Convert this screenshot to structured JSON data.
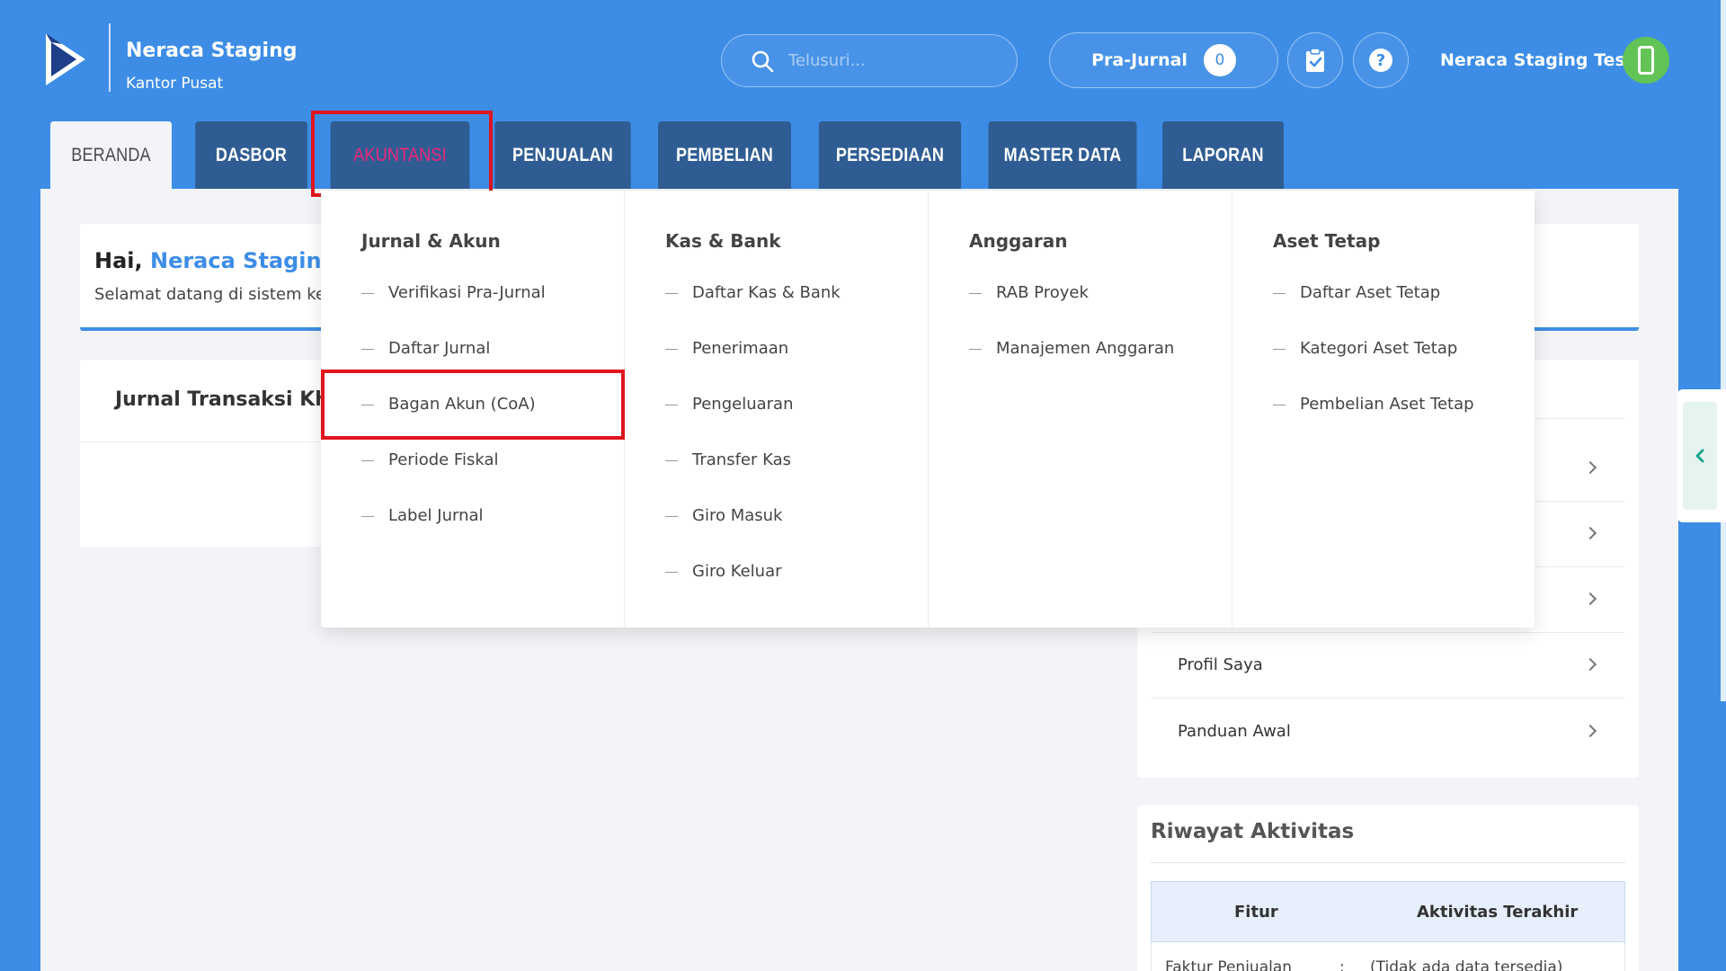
{
  "brand": {
    "title": "Neraca Staging",
    "subtitle": "Kantor Pusat"
  },
  "search": {
    "placeholder": "Telusuri..."
  },
  "prajurnal": {
    "label": "Pra-Jurnal",
    "count": "0"
  },
  "user": {
    "name": "Neraca Staging Test"
  },
  "tabs": [
    "BERANDA",
    "DASBOR",
    "AKUNTANSI",
    "PENJUALAN",
    "PEMBELIAN",
    "PERSEDIAAN",
    "MASTER DATA",
    "LAPORAN"
  ],
  "welcome": {
    "greeting": "Hai,",
    "name": "Neraca Staging Te",
    "message": "Selamat datang di sistem keu"
  },
  "jurnal_card": {
    "title": "Jurnal Transaksi Khu"
  },
  "side_menu": [
    "Profil Saya",
    "Panduan Awal"
  ],
  "riwayat": {
    "title": "Riwayat Aktivitas",
    "col_fitur": "Fitur",
    "col_aktivitas": "Aktivitas Terakhir",
    "row_fitur": "Faktur Penjualan",
    "row_sep": ":",
    "row_value": "(Tidak ada data tersedia)"
  },
  "mega_menu": {
    "columns": [
      {
        "header": "Jurnal & Akun",
        "items": [
          "Verifikasi Pra-Jurnal",
          "Daftar Jurnal",
          "Bagan Akun (CoA)",
          "Periode Fiskal",
          "Label Jurnal"
        ]
      },
      {
        "header": "Kas & Bank",
        "items": [
          "Daftar Kas & Bank",
          "Penerimaan",
          "Pengeluaran",
          "Transfer Kas",
          "Giro Masuk",
          "Giro Keluar"
        ]
      },
      {
        "header": "Anggaran",
        "items": [
          "RAB Proyek",
          "Manajemen Anggaran"
        ]
      },
      {
        "header": "Aset Tetap",
        "items": [
          "Daftar Aset Tetap",
          "Kategori Aset Tetap",
          "Pembelian Aset Tetap"
        ]
      }
    ]
  },
  "colors": {
    "background": "#3d8de6",
    "tab": "#2f5d93",
    "highlight": "#e0151e",
    "active_menu": "#f0267c"
  }
}
